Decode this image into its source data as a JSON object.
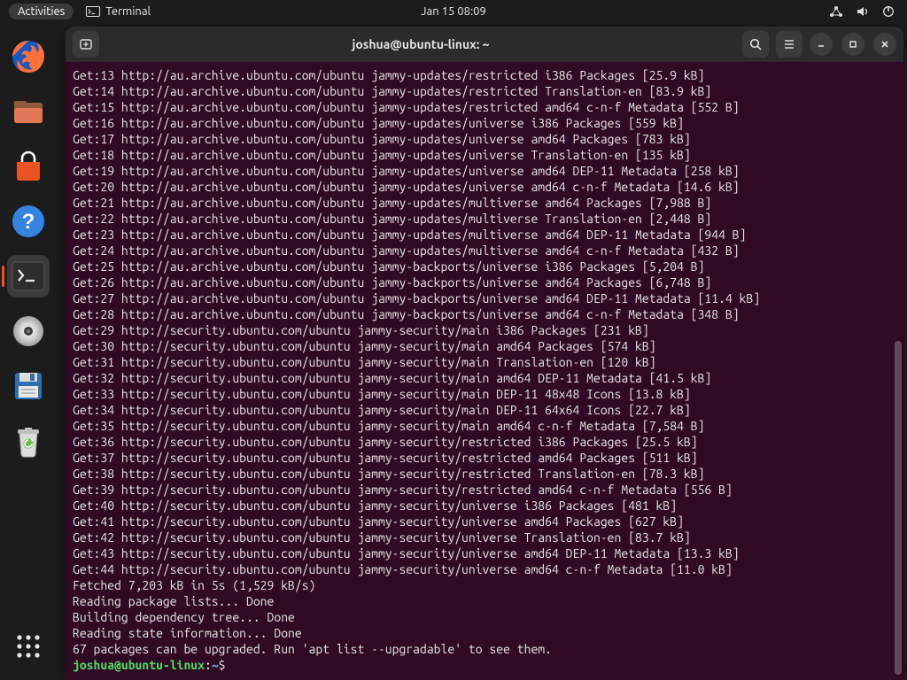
{
  "topbar": {
    "activities": "Activities",
    "app_name": "Terminal",
    "clock": "Jan 15  08:09"
  },
  "dock": {
    "items": [
      {
        "name": "firefox",
        "semantic": "firefox-icon"
      },
      {
        "name": "files",
        "semantic": "files-icon"
      },
      {
        "name": "software",
        "semantic": "software-store-icon"
      },
      {
        "name": "help",
        "semantic": "help-icon"
      },
      {
        "name": "terminal",
        "semantic": "terminal-icon",
        "active": true
      },
      {
        "name": "disks",
        "semantic": "disks-icon"
      },
      {
        "name": "save",
        "semantic": "floppy-icon"
      },
      {
        "name": "trash",
        "semantic": "trash-icon"
      }
    ],
    "apps_button": "apps-grid-icon"
  },
  "terminal": {
    "title": "joshua@ubuntu-linux: ~",
    "lines": [
      "Get:13 http://au.archive.ubuntu.com/ubuntu jammy-updates/restricted i386 Packages [25.9 kB]",
      "Get:14 http://au.archive.ubuntu.com/ubuntu jammy-updates/restricted Translation-en [83.9 kB]",
      "Get:15 http://au.archive.ubuntu.com/ubuntu jammy-updates/restricted amd64 c-n-f Metadata [552 B]",
      "Get:16 http://au.archive.ubuntu.com/ubuntu jammy-updates/universe i386 Packages [559 kB]",
      "Get:17 http://au.archive.ubuntu.com/ubuntu jammy-updates/universe amd64 Packages [783 kB]",
      "Get:18 http://au.archive.ubuntu.com/ubuntu jammy-updates/universe Translation-en [135 kB]",
      "Get:19 http://au.archive.ubuntu.com/ubuntu jammy-updates/universe amd64 DEP-11 Metadata [258 kB]",
      "Get:20 http://au.archive.ubuntu.com/ubuntu jammy-updates/universe amd64 c-n-f Metadata [14.6 kB]",
      "Get:21 http://au.archive.ubuntu.com/ubuntu jammy-updates/multiverse amd64 Packages [7,988 B]",
      "Get:22 http://au.archive.ubuntu.com/ubuntu jammy-updates/multiverse Translation-en [2,448 B]",
      "Get:23 http://au.archive.ubuntu.com/ubuntu jammy-updates/multiverse amd64 DEP-11 Metadata [944 B]",
      "Get:24 http://au.archive.ubuntu.com/ubuntu jammy-updates/multiverse amd64 c-n-f Metadata [432 B]",
      "Get:25 http://au.archive.ubuntu.com/ubuntu jammy-backports/universe i386 Packages [5,204 B]",
      "Get:26 http://au.archive.ubuntu.com/ubuntu jammy-backports/universe amd64 Packages [6,748 B]",
      "Get:27 http://au.archive.ubuntu.com/ubuntu jammy-backports/universe amd64 DEP-11 Metadata [11.4 kB]",
      "Get:28 http://au.archive.ubuntu.com/ubuntu jammy-backports/universe amd64 c-n-f Metadata [348 B]",
      "Get:29 http://security.ubuntu.com/ubuntu jammy-security/main i386 Packages [231 kB]",
      "Get:30 http://security.ubuntu.com/ubuntu jammy-security/main amd64 Packages [574 kB]",
      "Get:31 http://security.ubuntu.com/ubuntu jammy-security/main Translation-en [120 kB]",
      "Get:32 http://security.ubuntu.com/ubuntu jammy-security/main amd64 DEP-11 Metadata [41.5 kB]",
      "Get:33 http://security.ubuntu.com/ubuntu jammy-security/main DEP-11 48x48 Icons [13.8 kB]",
      "Get:34 http://security.ubuntu.com/ubuntu jammy-security/main DEP-11 64x64 Icons [22.7 kB]",
      "Get:35 http://security.ubuntu.com/ubuntu jammy-security/main amd64 c-n-f Metadata [7,584 B]",
      "Get:36 http://security.ubuntu.com/ubuntu jammy-security/restricted i386 Packages [25.5 kB]",
      "Get:37 http://security.ubuntu.com/ubuntu jammy-security/restricted amd64 Packages [511 kB]",
      "Get:38 http://security.ubuntu.com/ubuntu jammy-security/restricted Translation-en [78.3 kB]",
      "Get:39 http://security.ubuntu.com/ubuntu jammy-security/restricted amd64 c-n-f Metadata [556 B]",
      "Get:40 http://security.ubuntu.com/ubuntu jammy-security/universe i386 Packages [481 kB]",
      "Get:41 http://security.ubuntu.com/ubuntu jammy-security/universe amd64 Packages [627 kB]",
      "Get:42 http://security.ubuntu.com/ubuntu jammy-security/universe Translation-en [83.7 kB]",
      "Get:43 http://security.ubuntu.com/ubuntu jammy-security/universe amd64 DEP-11 Metadata [13.3 kB]",
      "Get:44 http://security.ubuntu.com/ubuntu jammy-security/universe amd64 c-n-f Metadata [11.0 kB]",
      "Fetched 7,203 kB in 5s (1,529 kB/s)",
      "Reading package lists... Done",
      "Building dependency tree... Done",
      "Reading state information... Done",
      "67 packages can be upgraded. Run 'apt list --upgradable' to see them."
    ],
    "prompt": {
      "user_host": "joshua@ubuntu-linux",
      "sep": ":",
      "path": "~",
      "suffix": "$"
    }
  }
}
